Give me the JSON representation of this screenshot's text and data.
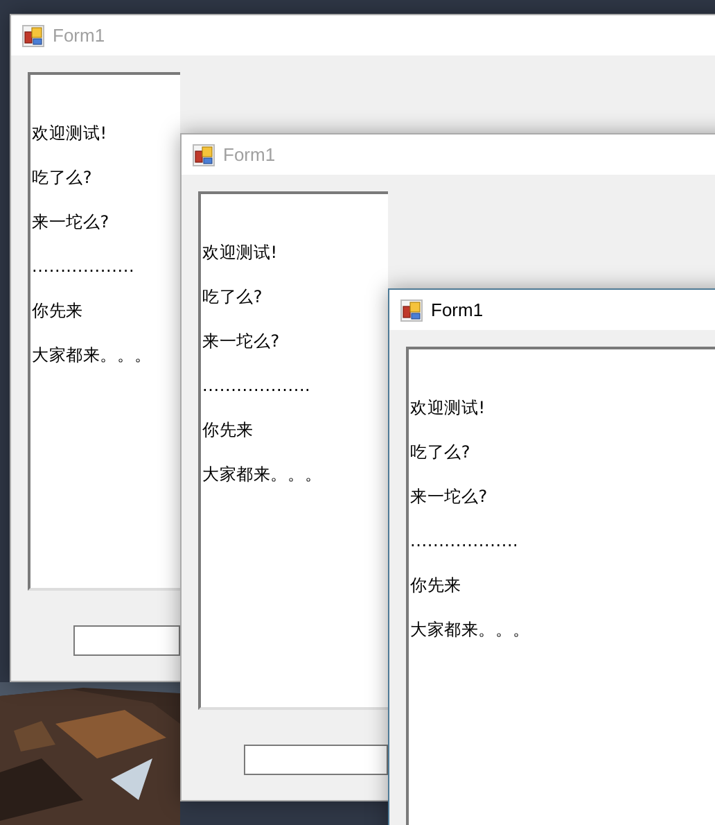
{
  "windows": [
    {
      "title": "Form1",
      "active": false,
      "input_shown": true,
      "lines": [
        "欢迎测试!",
        "吃了么?",
        "来一坨么?",
        "..................",
        "你先来",
        "大家都来。。。"
      ]
    },
    {
      "title": "Form1",
      "active": false,
      "input_shown": true,
      "lines": [
        "欢迎测试!",
        "吃了么?",
        "来一坨么?",
        "...................",
        "你先来",
        "大家都来。。。"
      ]
    },
    {
      "title": "Form1",
      "active": true,
      "input_shown": false,
      "lines": [
        "欢迎测试!",
        "吃了么?",
        "来一坨么?",
        "...................",
        "你先来",
        "大家都来。。。"
      ]
    }
  ]
}
